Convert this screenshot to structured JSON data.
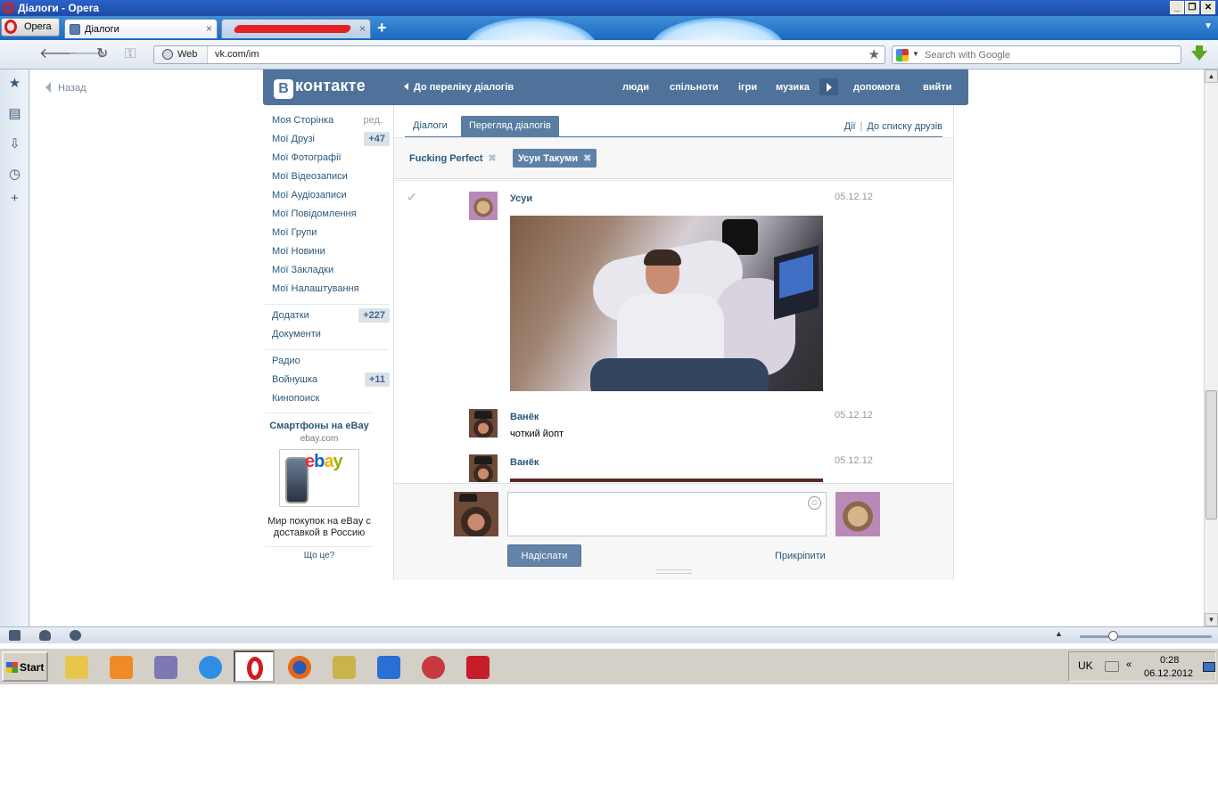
{
  "window": {
    "title": "Діалоги - Opera",
    "min": "_",
    "restore": "❐",
    "close": "✕"
  },
  "tabs": {
    "menu_label": "Opera",
    "items": [
      {
        "label": "Діалоги",
        "close": "×"
      },
      {
        "label": "",
        "close": "×"
      }
    ],
    "new_tab": "+",
    "tab_menu": "▼"
  },
  "navbar": {
    "back": "🡐",
    "forward": "🡒",
    "reload": "↻",
    "wand": "⚿",
    "site_badge": "Web",
    "url": "vk.com/im",
    "bookmark_star": "★",
    "search_placeholder": "Search with Google",
    "search_dropdown": "▼"
  },
  "side_panel": {
    "icons": [
      "bookmarks-icon",
      "notes-icon",
      "downloads-icon",
      "history-icon",
      "add-panel-icon"
    ],
    "glyphs": [
      "★",
      "▤",
      "⇩",
      "◷",
      "+"
    ]
  },
  "page": {
    "back_label": "Назад",
    "vk": {
      "logo_letter": "В",
      "logo_text": "контакте",
      "back_to_dialogs": "До переліку діалогів",
      "nav": [
        "люди",
        "спільноти",
        "ігри",
        "музика",
        "допомога",
        "вийти"
      ]
    },
    "left_menu": {
      "items": [
        {
          "label": "Моя Сторінка",
          "edit": "ред."
        },
        {
          "label": "Мої Друзі",
          "badge": "+47"
        },
        {
          "label": "Мої Фотографії"
        },
        {
          "label": "Мої Відеозаписи"
        },
        {
          "label": "Мої Аудіозаписи"
        },
        {
          "label": "Мої Повідомлення"
        },
        {
          "label": "Мої Групи"
        },
        {
          "label": "Мої Новини"
        },
        {
          "label": "Мої Закладки"
        },
        {
          "label": "Мої Налаштування"
        }
      ],
      "apps": [
        {
          "label": "Додатки",
          "badge": "+227"
        },
        {
          "label": "Документи"
        }
      ],
      "extra": [
        {
          "label": "Радио"
        },
        {
          "label": "Войнушка",
          "badge": "+11"
        },
        {
          "label": "Кинопоиск"
        }
      ]
    },
    "ad": {
      "title": "Смартфоны на eBay",
      "domain": "ebay.com",
      "text": "Мир покупок на eBay с доставкой в Россию",
      "help": "Що це?",
      "logo_letters": [
        "e",
        "b",
        "a",
        "y"
      ],
      "logo_colors": [
        "#e53238",
        "#0064d2",
        "#f5af02",
        "#86b817"
      ]
    },
    "dialogs": {
      "tabs": [
        "Діалоги",
        "Перегляд діалогів"
      ],
      "active_tab": 1,
      "actions": "Дії",
      "to_friends": "До списку друзів",
      "peers": [
        {
          "name": "Fucking Perfect",
          "selected": false
        },
        {
          "name": "Усуи Такуми",
          "selected": true
        }
      ],
      "messages": [
        {
          "author": "Усуи",
          "date": "05.12.12",
          "text": "",
          "has_photo": true,
          "avatar": "dog"
        },
        {
          "author": "Ванёк",
          "date": "05.12.12",
          "text": "чоткий йопт",
          "has_photo": false,
          "avatar": "man"
        },
        {
          "author": "Ванёк",
          "date": "05.12.12",
          "text": "",
          "has_photo": true,
          "avatar": "man"
        }
      ],
      "compose": {
        "value": "",
        "send": "Надіслати",
        "attach": "Прикріпити",
        "smile": "☺"
      }
    }
  },
  "statusbar": {
    "zoom_level": 0.25
  },
  "taskbar": {
    "start": "Start",
    "apps": [
      {
        "name": "explorer-icon",
        "color": "#e8c64a"
      },
      {
        "name": "media-player-icon",
        "color": "#f08a24"
      },
      {
        "name": "floppy-icon",
        "color": "#7c79b3"
      },
      {
        "name": "internet-explorer-icon",
        "color": "#2f8de4"
      },
      {
        "name": "opera-icon",
        "color": "#d11b1b"
      },
      {
        "name": "firefox-icon",
        "color": "#e66a16"
      },
      {
        "name": "hxd-icon",
        "color": "#c9b34a"
      },
      {
        "name": "rocket-icon",
        "color": "#2a6fd6"
      },
      {
        "name": "disc-icon",
        "color": "#c8383f"
      },
      {
        "name": "kaspersky-icon",
        "color": "#c61d2a"
      }
    ],
    "tray": {
      "lang": "UK",
      "expand": "«",
      "time": "0:28",
      "date": "06.12.2012"
    }
  }
}
